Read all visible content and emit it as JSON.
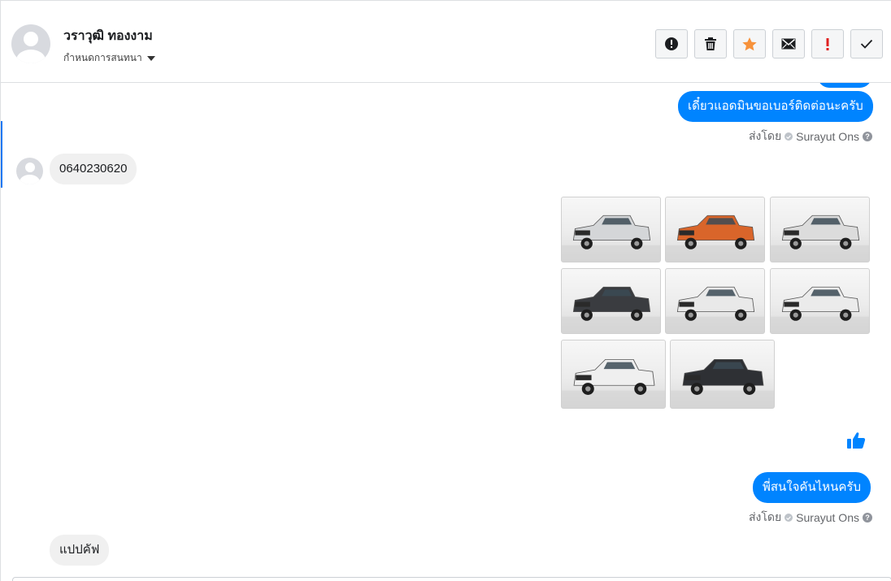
{
  "header": {
    "contact_name": "วราวุฒิ ทองงาม",
    "status_label": "กำหนดการสนทนา",
    "actions": [
      {
        "name": "report-spam-button",
        "icon": "alert-circle-icon"
      },
      {
        "name": "delete-button",
        "icon": "trash-icon"
      },
      {
        "name": "star-button",
        "icon": "star-icon"
      },
      {
        "name": "mark-unread-button",
        "icon": "envelope-icon"
      },
      {
        "name": "mark-important-button",
        "icon": "exclamation-icon"
      },
      {
        "name": "mark-done-button",
        "icon": "check-icon"
      }
    ]
  },
  "messages": {
    "out_1": {
      "text": "เดี๋ยวแอดมินขอเบอร์ติดต่อนะครับ",
      "sent_by_label": "ส่งโดย",
      "agent": "Surayut Ons",
      "help": "?"
    },
    "in_1": {
      "text": "0640230620"
    },
    "images": [
      {
        "alt": "Silver pickup truck front-left",
        "car_color": "#d4d6d8"
      },
      {
        "alt": "Orange pickup truck front-left",
        "car_color": "#d9652a"
      },
      {
        "alt": "Silver pickup truck front-left",
        "car_color": "#dcdcdc"
      },
      {
        "alt": "Dark grey pickup truck front-left",
        "car_color": "#3a3c40"
      },
      {
        "alt": "White pickup truck front-left",
        "car_color": "#e9e9e9"
      },
      {
        "alt": "White pickup truck front-left",
        "car_color": "#ebebeb"
      },
      {
        "alt": "White pickup truck front-left",
        "car_color": "#efefef"
      },
      {
        "alt": "Black pickup truck front-left",
        "car_color": "#2e3034"
      }
    ],
    "like_icon": "thumbs-up-icon",
    "out_2": {
      "text": "พี่สนใจคันไหนครับ",
      "sent_by_label": "ส่งโดย",
      "agent": "Surayut Ons",
      "help": "?"
    },
    "in_2": {
      "text": "แปปคัฟ"
    }
  },
  "colors": {
    "accent": "#0084ff",
    "star": "#f7923b",
    "important": "#e02020",
    "incoming_bubble": "#f0f0f0"
  }
}
